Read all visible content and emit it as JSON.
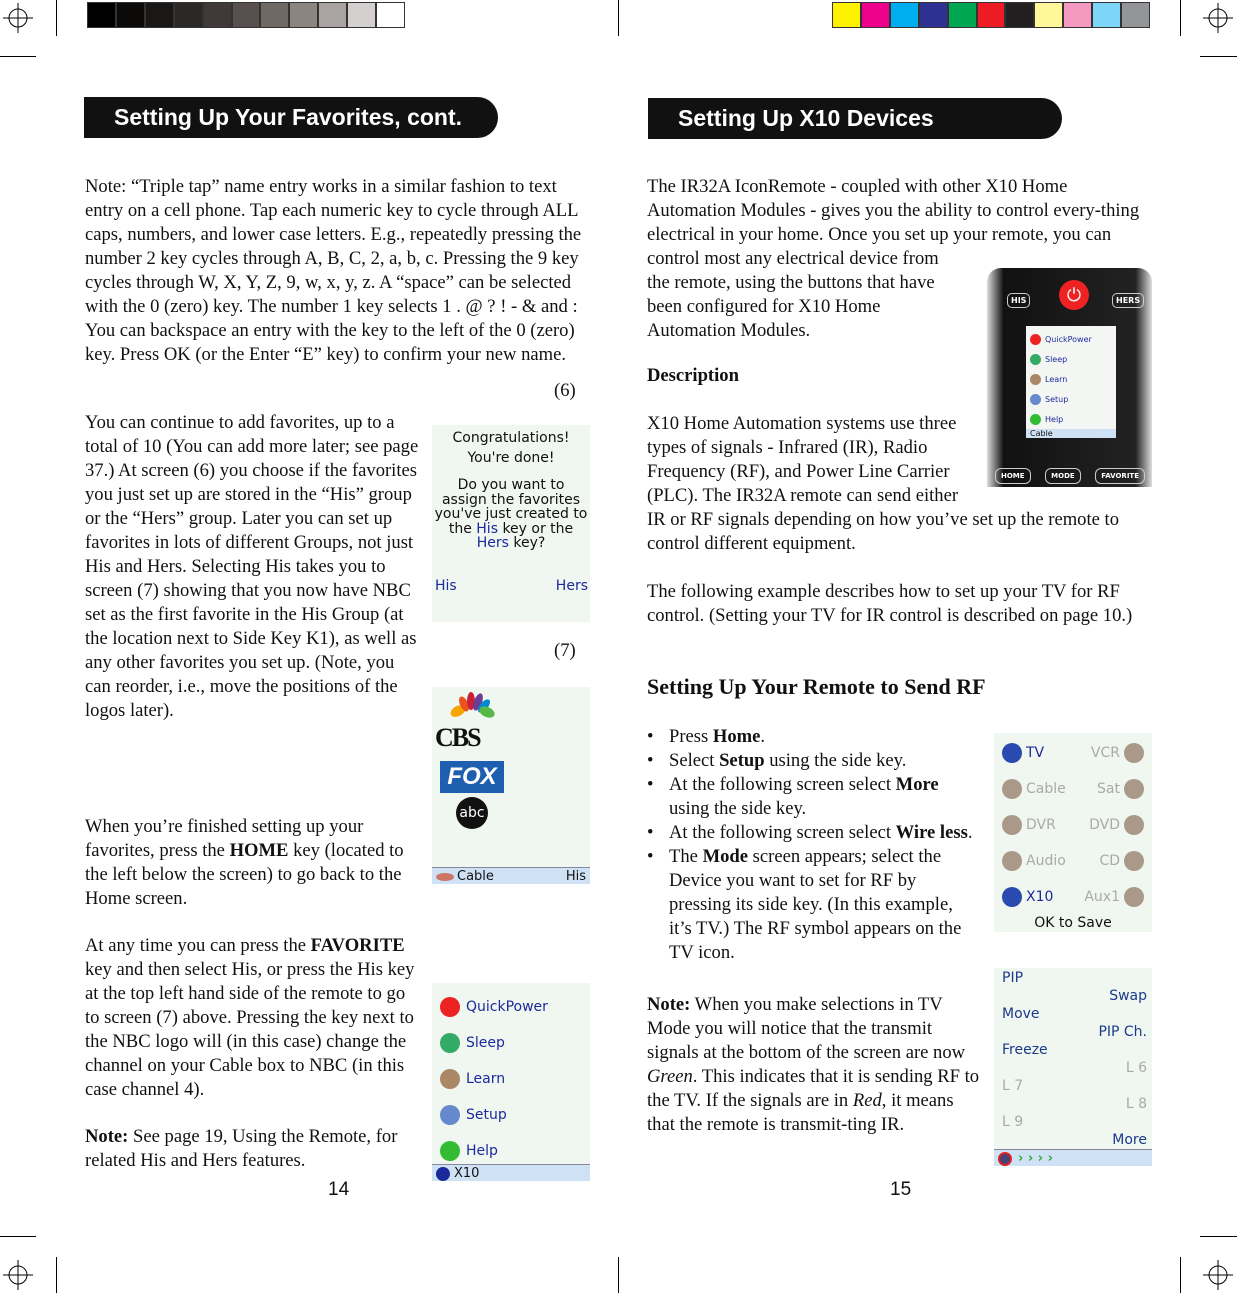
{
  "colors": {
    "grayscale": [
      "#000000",
      "#0c0a09",
      "#1a1817",
      "#2b2826",
      "#3f3a38",
      "#57504e",
      "#6f6966",
      "#8b8582",
      "#a9a4a2",
      "#d4d0cf",
      "#ffffff"
    ],
    "process": [
      "#fff200",
      "#ec008c",
      "#00aeef",
      "#2e3192",
      "#00a651",
      "#ed1c24",
      "#231f20",
      "#fff799",
      "#f49ac1",
      "#7dd5f7",
      "#939598"
    ]
  },
  "left": {
    "header": "Setting Up Your Favorites, cont.",
    "paragraphs": [
      [
        {
          "t": "Note: “Triple tap” name entry works in a similar fashion to text entry on a cell phone. Tap each numeric key to cycle through ALL caps, numbers, and lower case letters. E.g., repeatedly pressing the number 2 key cycles through A, B, C, 2, a, b, c. Pressing the 9 key cycles through W, X, Y, Z, 9, w, x, y, z. A “space” can be selected with the 0 (zero) key. The number 1 key selects 1 . @ ? ! - & and :  You can backspace an entry with the key to the left of the 0 (zero) key. Press OK (or the Enter “E” key) to confirm your new name."
        }
      ],
      [
        {
          "t": "You can continue to add favorites, up to a total of 10 (You can add more later; see page 37.) At screen (6) you choose if the favorites you just set up are stored in the “His” group or the “Hers” group. Later you can set up favorites in lots of different Groups, not just His and Hers. Selecting His takes you to screen (7) showing that you now have NBC set as the first favorite in the His Group (at the location next to Side Key K1), as well as any other favorites you set up. (Note, you can reorder, i.e., move the positions of the logos later)."
        }
      ],
      [
        {
          "t": "When you’re finished setting up your favorites, press the "
        },
        {
          "t": "HOME",
          "b": 1
        },
        {
          "t": " key (located to the left below the screen) to go back to the Home screen."
        }
      ],
      [
        {
          "t": "At any time you can press the "
        },
        {
          "t": "FAVORITE",
          "b": 1
        },
        {
          "t": " key and then select His, or press the His key at the top left hand side of the remote to go to screen (7) above. Pressing the key next to the NBC logo will (in this case) change the channel on your Cable box to NBC (in this case channel 4)."
        }
      ],
      [
        {
          "t": "Note:",
          "b": 1
        },
        {
          "t": " See page 19, Using the Remote, for related His and Hers features."
        }
      ]
    ],
    "screen6": {
      "caption": "(6)",
      "l1": "Congratulations!",
      "l2": "You're done!",
      "l3a": "Do you want to assign the favorites you've just created to the ",
      "his": "His",
      "l3b": " key or the ",
      "hers": "Hers",
      "l3c": " key?",
      "left_btn": "His",
      "right_btn": "Hers"
    },
    "screen7": {
      "caption": "(7)",
      "logos": [
        "NBC",
        "CBS",
        "FOX",
        "abc"
      ],
      "bar_left": "Cable",
      "bar_right": "His"
    },
    "menu": {
      "items": [
        "QuickPower",
        "Sleep",
        "Learn",
        "Setup",
        "Help"
      ],
      "bar": "X10"
    },
    "page_number": "14"
  },
  "right": {
    "header": "Setting Up X10 Devices",
    "p1": "The IR32A IconRemote - coupled with other X10 Home Automation Modules - gives you the ability to control every-thing electrical in your home. Once you set up your remote, you can control most any electrical device from the remote, using the buttons that have been configured for X10 Home Automation Modules.",
    "description_heading": "Description",
    "p2": "X10 Home Automation systems use three types of signals - Infrared (IR), Radio Frequency (RF), and Power Line Carrier (PLC). The IR32A remote can send either IR or RF signals depending on how you’ve set up the remote to control different equipment.",
    "p3": "The following example describes how to set up your TV for RF control. (Setting your TV for IR control is described on page 10.)",
    "rf_heading": "Setting Up Your Remote to Send RF",
    "bullets": [
      [
        {
          "t": "Press "
        },
        {
          "t": "Home",
          "b": 1
        },
        {
          "t": "."
        }
      ],
      [
        {
          "t": "Select "
        },
        {
          "t": "Setup",
          "b": 1
        },
        {
          "t": " using the side key."
        }
      ],
      [
        {
          "t": "At the following screen select "
        },
        {
          "t": "More",
          "b": 1
        },
        {
          "t": " using the side key."
        }
      ],
      [
        {
          "t": "At the following screen select "
        },
        {
          "t": "Wire less",
          "b": 1
        },
        {
          "t": "."
        }
      ],
      [
        {
          "t": "The "
        },
        {
          "t": "Mode",
          "b": 1
        },
        {
          "t": " screen appears; select the Device you want to set for RF by pressing its side key. (In this example, it’s TV.) The RF symbol appears on the TV icon."
        }
      ]
    ],
    "note": [
      {
        "t": "Note:",
        "b": 1
      },
      {
        "t": " When you make selections in TV Mode you will notice that the transmit signals at the bottom of the screen are now "
      },
      {
        "t": "Green",
        "i": 1
      },
      {
        "t": ". This indicates that it is sending RF to the TV. If the signals are in "
      },
      {
        "t": "Red",
        "i": 1
      },
      {
        "t": ", it means that the remote is transmit-ting IR."
      }
    ],
    "remote": {
      "top_left": "HIS",
      "top_right": "HERS",
      "menu": [
        "QuickPower",
        "Sleep",
        "Learn",
        "Setup",
        "Help"
      ],
      "bar": "Cable",
      "bottom": [
        "HOME",
        "MODE",
        "FAVORITE"
      ]
    },
    "devices": {
      "left": [
        "TV",
        "Cable",
        "DVR",
        "Audio",
        "X10"
      ],
      "right": [
        "VCR",
        "Sat",
        "DVD",
        "CD",
        "Aux1"
      ],
      "footer": "OK to Save"
    },
    "pip": {
      "left": [
        "PIP",
        "Move",
        "Freeze",
        "L 7",
        "L 9"
      ],
      "right": [
        "Swap",
        "PIP Ch.",
        "L 6",
        "L 8",
        "More"
      ]
    },
    "page_number": "15"
  }
}
